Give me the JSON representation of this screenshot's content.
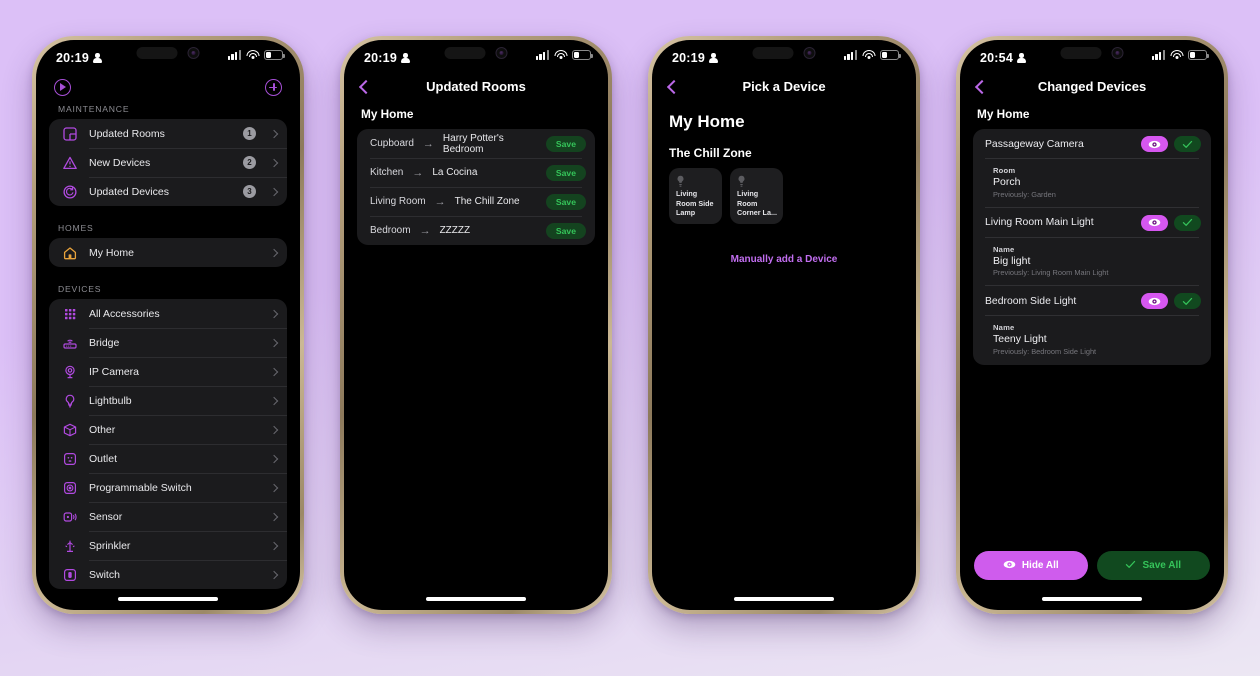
{
  "background": {
    "top_color": "#dcc0f7",
    "bottom_color": "#ece7f3"
  },
  "phones": {
    "phone1": {
      "status_bar": {
        "time": "20:19",
        "person_icon": "person-icon",
        "signal_icon": "cellular-signal-icon",
        "wifi_icon": "wifi-icon",
        "battery_icon": "battery-icon"
      },
      "toolbar": {
        "left_icon": "play-circle-icon",
        "right_icon": "plus-circle-icon"
      },
      "sections": [
        {
          "label": "MAINTENANCE",
          "rows": [
            {
              "icon": "updated-rooms-icon",
              "label": "Updated Rooms",
              "badge": "1"
            },
            {
              "icon": "warning-triangle-icon",
              "label": "New Devices",
              "badge": "2"
            },
            {
              "icon": "refresh-circle-icon",
              "label": "Updated Devices",
              "badge": "3"
            }
          ]
        },
        {
          "label": "HOMES",
          "rows": [
            {
              "icon": "home-icon",
              "label": "My Home",
              "badge": ""
            }
          ]
        },
        {
          "label": "DEVICES",
          "rows": [
            {
              "icon": "grid-icon",
              "label": "All Accessories",
              "badge": ""
            },
            {
              "icon": "bridge-icon",
              "label": "Bridge",
              "badge": ""
            },
            {
              "icon": "ip-camera-icon",
              "label": "IP Camera",
              "badge": ""
            },
            {
              "icon": "lightbulb-icon",
              "label": "Lightbulb",
              "badge": ""
            },
            {
              "icon": "box-icon",
              "label": "Other",
              "badge": ""
            },
            {
              "icon": "outlet-icon",
              "label": "Outlet",
              "badge": ""
            },
            {
              "icon": "programmable-switch-icon",
              "label": "Programmable Switch",
              "badge": ""
            },
            {
              "icon": "sensor-icon",
              "label": "Sensor",
              "badge": ""
            },
            {
              "icon": "sprinkler-icon",
              "label": "Sprinkler",
              "badge": ""
            },
            {
              "icon": "switch-icon",
              "label": "Switch",
              "badge": ""
            }
          ]
        }
      ]
    },
    "phone2": {
      "status_bar": {
        "time": "20:19"
      },
      "nav": {
        "back_icon": "back-chevron-icon",
        "title": "Updated Rooms"
      },
      "home_title": "My Home",
      "rooms": [
        {
          "from": "Cupboard",
          "arrow": "→",
          "to": "Harry Potter's Bedroom",
          "action": "Save"
        },
        {
          "from": "Kitchen",
          "arrow": "→",
          "to": "La Cocina",
          "action": "Save"
        },
        {
          "from": "Living Room",
          "arrow": "→",
          "to": "The Chill Zone",
          "action": "Save"
        },
        {
          "from": "Bedroom",
          "arrow": "→",
          "to": "ZZZZZ",
          "action": "Save"
        }
      ]
    },
    "phone3": {
      "status_bar": {
        "time": "20:19"
      },
      "nav": {
        "back_icon": "back-chevron-icon",
        "title": "Pick a Device"
      },
      "home_title": "My Home",
      "zone_title": "The Chill Zone",
      "tiles": [
        {
          "icon": "lightbulb-icon",
          "name": "Living Room Side Lamp"
        },
        {
          "icon": "lightbulb-icon",
          "name": "Living Room Corner La..."
        }
      ],
      "manual_link": "Manually add a Device"
    },
    "phone4": {
      "status_bar": {
        "time": "20:54"
      },
      "nav": {
        "back_icon": "back-chevron-icon",
        "title": "Changed Devices"
      },
      "home_title": "My Home",
      "devices": [
        {
          "name": "Passageway Camera",
          "hide_icon": "eye-icon",
          "save_icon": "check-icon",
          "detail_key": "Room",
          "detail_value": "Porch",
          "detail_previous": "Previously: Garden"
        },
        {
          "name": "Living Room Main Light",
          "hide_icon": "eye-icon",
          "save_icon": "check-icon",
          "detail_key": "Name",
          "detail_value": "Big light",
          "detail_previous": "Previously: Living Room Main Light"
        },
        {
          "name": "Bedroom Side Light",
          "hide_icon": "eye-icon",
          "save_icon": "check-icon",
          "detail_key": "Name",
          "detail_value": "Teeny Light",
          "detail_previous": "Previously: Bedroom Side Light"
        }
      ],
      "footer": {
        "hide_all": "Hide All",
        "hide_all_icon": "eye-icon",
        "save_all": "Save All",
        "save_all_icon": "check-icon"
      }
    }
  },
  "colors": {
    "accent_purple": "#a64fd6",
    "link_purple": "#c26ef0",
    "pill_magenta": "#d657f0",
    "green_dark": "#11491f",
    "green_text": "#35c45a",
    "home_orange": "#e8a33c"
  }
}
